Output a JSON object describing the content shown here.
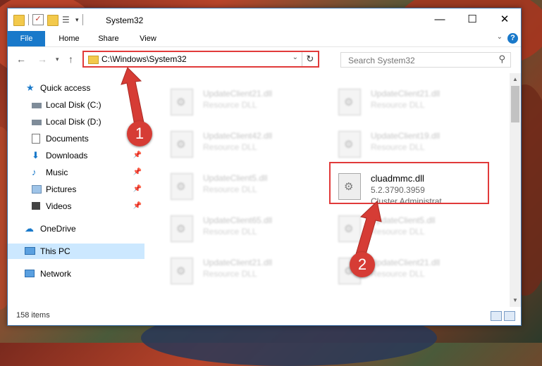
{
  "window": {
    "title": "System32",
    "controls": {
      "minimize": "—",
      "maximize": "☐",
      "close": "✕"
    }
  },
  "ribbon": {
    "tabs": [
      "File",
      "Home",
      "Share",
      "View"
    ],
    "help": "?"
  },
  "navigation": {
    "address": "C:\\Windows\\System32",
    "search_placeholder": "Search System32"
  },
  "sidebar": {
    "items": [
      {
        "label": "Quick access",
        "icon": "star-icon"
      },
      {
        "label": "Local Disk (C:)",
        "icon": "drive-icon"
      },
      {
        "label": "Local Disk (D:)",
        "icon": "drive-icon"
      },
      {
        "label": "Documents",
        "icon": "documents-icon",
        "pinned": true
      },
      {
        "label": "Downloads",
        "icon": "downloads-icon",
        "pinned": true
      },
      {
        "label": "Music",
        "icon": "music-icon",
        "pinned": true
      },
      {
        "label": "Pictures",
        "icon": "pictures-icon",
        "pinned": true
      },
      {
        "label": "Videos",
        "icon": "videos-icon",
        "pinned": true
      },
      {
        "label": "OneDrive",
        "icon": "cloud-icon"
      },
      {
        "label": "This PC",
        "icon": "computer-icon",
        "selected": true
      },
      {
        "label": "Network",
        "icon": "network-icon"
      }
    ]
  },
  "files": [
    {
      "name": "UpdateClient21.dll",
      "desc": "Resource DLL"
    },
    {
      "name": "UpdateClient21.dll",
      "desc": "Resource DLL"
    },
    {
      "name": "UpdateClient42.dll",
      "desc": "Resource DLL"
    },
    {
      "name": "UpdateClient19.dll",
      "desc": "Resource DLL"
    },
    {
      "name": "UpdateClient5.dll",
      "desc": "Resource DLL"
    },
    {
      "name": "cluadmmc.dll",
      "version": "5.2.3790.3959",
      "desc": "Cluster Administrat..."
    },
    {
      "name": "UpdateClient65.dll",
      "desc": "Resource DLL"
    },
    {
      "name": "UpdateClient5.dll",
      "desc": "Resource DLL"
    },
    {
      "name": "UpdateClient21.dll",
      "desc": "Resource DLL"
    },
    {
      "name": "UpdateClient21.dll",
      "desc": "Resource DLL"
    }
  ],
  "status": {
    "item_count": "158 items"
  },
  "callouts": {
    "one": "1",
    "two": "2"
  },
  "colors": {
    "accent": "#1979ca",
    "highlight": "#e13a3a",
    "badge": "#d63c35"
  }
}
